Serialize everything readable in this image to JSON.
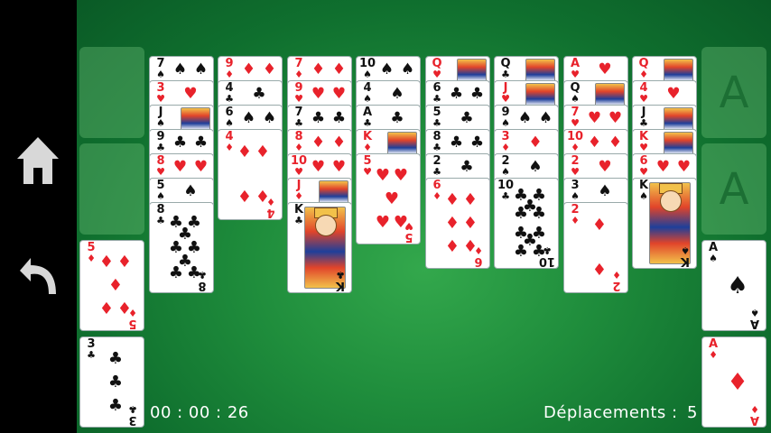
{
  "hud": {
    "timer": "00 : 00 : 26",
    "moves_label": "Déplacements :",
    "moves_value": "5"
  },
  "nav": {
    "home_icon": "home-icon",
    "undo_icon": "undo-icon"
  },
  "foundations": [
    {
      "placeholder": "A"
    },
    {
      "placeholder": "A"
    }
  ],
  "colors": {
    "table": "#1f8d3c",
    "red_suit": "#e8222b",
    "black_suit": "#111111"
  },
  "free_cells": [
    {
      "rank": "5",
      "suit": "♦",
      "color": "red"
    },
    {
      "rank": "3",
      "suit": "♣",
      "color": "black"
    }
  ],
  "foundation_cards": [
    {
      "rank": "A",
      "suit": "♠",
      "color": "black"
    },
    {
      "rank": "A",
      "suit": "♦",
      "color": "red"
    }
  ],
  "tableau": [
    [
      {
        "rank": "7",
        "suit": "♠",
        "color": "black"
      },
      {
        "rank": "3",
        "suit": "♥",
        "color": "red"
      },
      {
        "rank": "J",
        "suit": "♠",
        "color": "black",
        "face": true
      },
      {
        "rank": "9",
        "suit": "♣",
        "color": "black"
      },
      {
        "rank": "8",
        "suit": "♥",
        "color": "red"
      },
      {
        "rank": "5",
        "suit": "♠",
        "color": "black"
      },
      {
        "rank": "8",
        "suit": "♣",
        "color": "black"
      }
    ],
    [
      {
        "rank": "9",
        "suit": "♦",
        "color": "red"
      },
      {
        "rank": "4",
        "suit": "♣",
        "color": "black"
      },
      {
        "rank": "6",
        "suit": "♠",
        "color": "black"
      },
      {
        "rank": "4",
        "suit": "♦",
        "color": "red"
      }
    ],
    [
      {
        "rank": "7",
        "suit": "♦",
        "color": "red"
      },
      {
        "rank": "9",
        "suit": "♥",
        "color": "red"
      },
      {
        "rank": "7",
        "suit": "♣",
        "color": "black"
      },
      {
        "rank": "8",
        "suit": "♦",
        "color": "red"
      },
      {
        "rank": "10",
        "suit": "♥",
        "color": "red"
      },
      {
        "rank": "J",
        "suit": "♦",
        "color": "red",
        "face": true
      },
      {
        "rank": "K",
        "suit": "♣",
        "color": "black",
        "face": true
      }
    ],
    [
      {
        "rank": "10",
        "suit": "♠",
        "color": "black"
      },
      {
        "rank": "4",
        "suit": "♠",
        "color": "black"
      },
      {
        "rank": "A",
        "suit": "♣",
        "color": "black"
      },
      {
        "rank": "K",
        "suit": "♦",
        "color": "red",
        "face": true
      },
      {
        "rank": "5",
        "suit": "♥",
        "color": "red"
      }
    ],
    [
      {
        "rank": "Q",
        "suit": "♥",
        "color": "red",
        "face": true
      },
      {
        "rank": "6",
        "suit": "♣",
        "color": "black"
      },
      {
        "rank": "5",
        "suit": "♣",
        "color": "black"
      },
      {
        "rank": "8",
        "suit": "♣",
        "color": "black"
      },
      {
        "rank": "2",
        "suit": "♣",
        "color": "black"
      },
      {
        "rank": "6",
        "suit": "♦",
        "color": "red"
      }
    ],
    [
      {
        "rank": "Q",
        "suit": "♣",
        "color": "black",
        "face": true
      },
      {
        "rank": "J",
        "suit": "♥",
        "color": "red",
        "face": true
      },
      {
        "rank": "9",
        "suit": "♠",
        "color": "black"
      },
      {
        "rank": "3",
        "suit": "♦",
        "color": "red"
      },
      {
        "rank": "2",
        "suit": "♠",
        "color": "black"
      },
      {
        "rank": "10",
        "suit": "♣",
        "color": "black"
      }
    ],
    [
      {
        "rank": "A",
        "suit": "♥",
        "color": "red"
      },
      {
        "rank": "Q",
        "suit": "♠",
        "color": "black",
        "face": true
      },
      {
        "rank": "7",
        "suit": "♥",
        "color": "red"
      },
      {
        "rank": "10",
        "suit": "♦",
        "color": "red"
      },
      {
        "rank": "2",
        "suit": "♥",
        "color": "red"
      },
      {
        "rank": "3",
        "suit": "♠",
        "color": "black"
      },
      {
        "rank": "2",
        "suit": "♦",
        "color": "red"
      }
    ],
    [
      {
        "rank": "Q",
        "suit": "♦",
        "color": "red",
        "face": true
      },
      {
        "rank": "4",
        "suit": "♥",
        "color": "red"
      },
      {
        "rank": "J",
        "suit": "♣",
        "color": "black",
        "face": true
      },
      {
        "rank": "K",
        "suit": "♥",
        "color": "red",
        "face": true
      },
      {
        "rank": "6",
        "suit": "♥",
        "color": "red"
      },
      {
        "rank": "K",
        "suit": "♠",
        "color": "black",
        "face": true
      }
    ]
  ]
}
